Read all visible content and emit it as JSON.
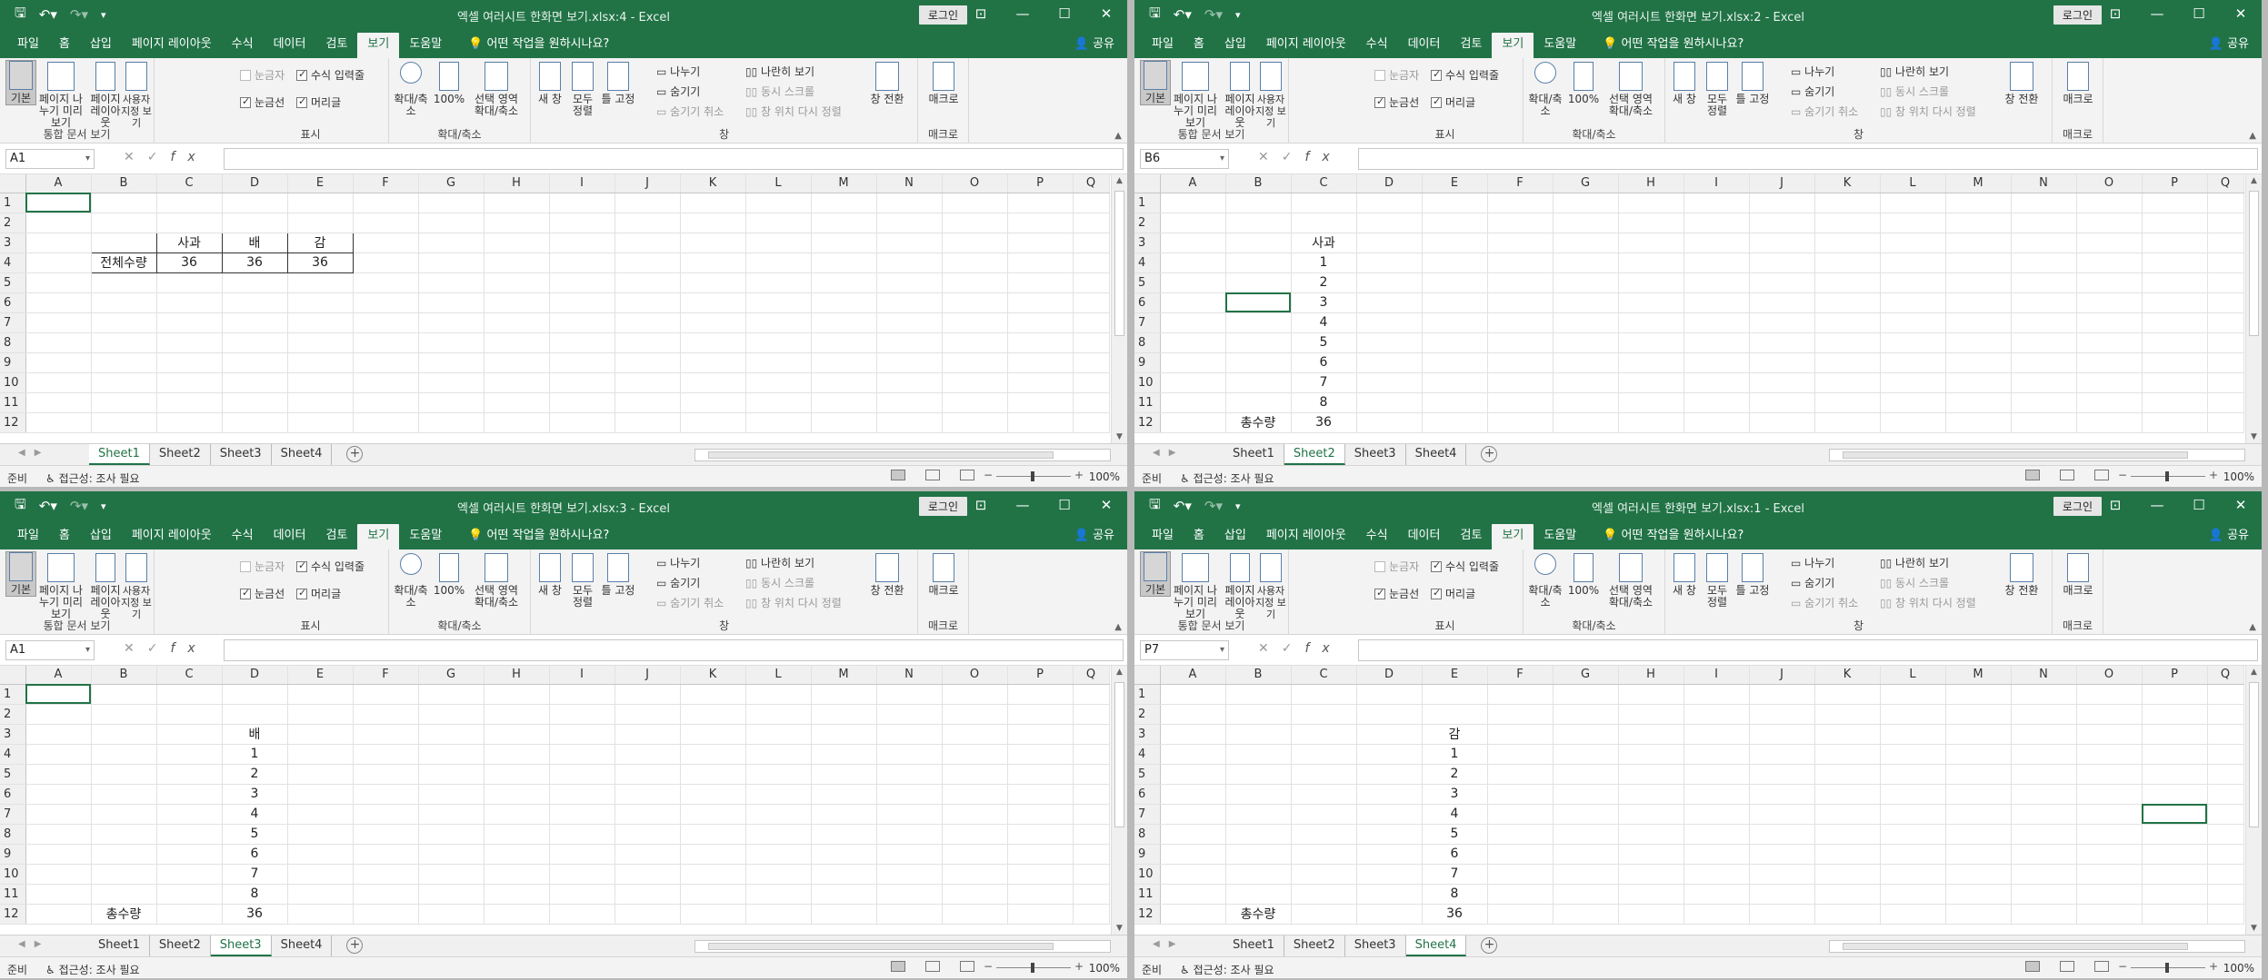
{
  "app": {
    "login_label": "로그인",
    "share_label": "공유",
    "tell_me": "어떤 작업을 원하시나요?",
    "tabs": [
      "파일",
      "홈",
      "삽입",
      "페이지 레이아웃",
      "수식",
      "데이터",
      "검토",
      "보기",
      "도움말"
    ],
    "active_tab_index": 7,
    "accent_color": "#217346"
  },
  "ribbon": {
    "workbook_views": {
      "normal": "기본",
      "page_break": "페이지 나누기 미리 보기",
      "page_layout": "페이지 레이아웃",
      "custom": "사용자 지정 보기",
      "group_label": "통합 문서 보기"
    },
    "show": {
      "ruler": "눈금자",
      "formula_bar": "수식 입력줄",
      "gridlines": "눈금선",
      "headings": "머리글",
      "group_label": "표시"
    },
    "zoom": {
      "zoom": "확대/축소",
      "hundred": "100%",
      "zoom_selection": "선택 영역 확대/축소",
      "group_label": "확대/축소"
    },
    "window": {
      "new_window": "새 창",
      "arrange_all": "모두 정렬",
      "freeze": "틀 고정",
      "split": "나누기",
      "hide": "숨기기",
      "unhide": "숨기기 취소",
      "side_by_side": "나란히 보기",
      "sync_scroll": "동시 스크롤",
      "reset_position": "창 위치 다시 정렬",
      "switch_windows": "창 전환",
      "group_label": "창"
    },
    "macros": {
      "label": "매크로",
      "group_label": "매크로"
    }
  },
  "columns": [
    "A",
    "B",
    "C",
    "D",
    "E",
    "F",
    "G",
    "H",
    "I",
    "J",
    "K",
    "L",
    "M",
    "N",
    "O",
    "P",
    "Q"
  ],
  "rows": [
    "1",
    "2",
    "3",
    "4",
    "5",
    "6",
    "7",
    "8",
    "9",
    "10",
    "11",
    "12"
  ],
  "sheet_tabs": [
    "Sheet1",
    "Sheet2",
    "Sheet3",
    "Sheet4"
  ],
  "status": {
    "ready": "준비",
    "accessibility": "접근성: 조사 필요",
    "zoom": "100%"
  },
  "windows": [
    {
      "title": "엑셀 여러시트 한화면 보기.xlsx:4  -  Excel",
      "namebox": "A1",
      "active_sheet": 0,
      "cells": {
        "C3": "사과",
        "D3": "배",
        "E3": "감",
        "B4": "전체수량",
        "C4": "36",
        "D4": "36",
        "E4": "36"
      }
    },
    {
      "title": "엑셀 여러시트 한화면 보기.xlsx:2  -  Excel",
      "namebox": "B6",
      "active_sheet": 1,
      "cells": {
        "C3": "사과",
        "C4": "1",
        "C5": "2",
        "C6": "3",
        "C7": "4",
        "C8": "5",
        "C9": "6",
        "C10": "7",
        "C11": "8",
        "B12": "총수량",
        "C12": "36"
      }
    },
    {
      "title": "엑셀 여러시트 한화면 보기.xlsx:3  -  Excel",
      "namebox": "A1",
      "active_sheet": 2,
      "cells": {
        "D3": "배",
        "D4": "1",
        "D5": "2",
        "D6": "3",
        "D7": "4",
        "D8": "5",
        "D9": "6",
        "D10": "7",
        "D11": "8",
        "B12": "총수량",
        "D12": "36"
      }
    },
    {
      "title": "엑셀 여러시트 한화면 보기.xlsx:1  -  Excel",
      "namebox": "P7",
      "active_sheet": 3,
      "cells": {
        "E3": "감",
        "E4": "1",
        "E5": "2",
        "E6": "3",
        "E7": "4",
        "E8": "5",
        "E9": "6",
        "E10": "7",
        "E11": "8",
        "B12": "총수량",
        "E12": "36"
      }
    }
  ]
}
